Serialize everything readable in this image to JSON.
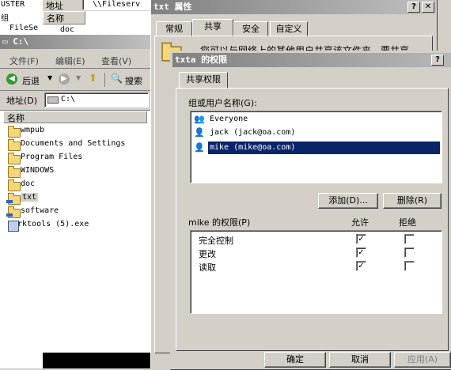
{
  "background_window": {
    "title_fragment": "USTER",
    "item": "组",
    "item2": "FileSe"
  },
  "second_window": {
    "address_label": "地址",
    "address_value": "\\\\Fileserv",
    "column_name": "名称",
    "row1": "doc"
  },
  "explorer": {
    "title": "C:\\",
    "menu": [
      "文件(F)",
      "编辑(E)",
      "查看(V)"
    ],
    "back_label": "后退",
    "search_label": "搜索",
    "address_label": "地址(D)",
    "address_value": "C:\\",
    "column_name": "名称",
    "items": [
      {
        "name": "wmpub",
        "icon": "folder-icon"
      },
      {
        "name": "Documents and Settings",
        "icon": "folder-icon"
      },
      {
        "name": "Program Files",
        "icon": "folder-icon"
      },
      {
        "name": "WINDOWS",
        "icon": "folder-icon"
      },
      {
        "name": "doc",
        "icon": "folder-icon"
      },
      {
        "name": "txt",
        "icon": "shared-folder-icon"
      },
      {
        "name": "software",
        "icon": "shared-folder-icon"
      },
      {
        "name": "rktools (5).exe",
        "icon": "exe-icon"
      }
    ]
  },
  "properties": {
    "title": "txt 属性",
    "tabs": [
      "常规",
      "共享",
      "安全",
      "自定义"
    ],
    "active_tab": "共享",
    "text_fragment": "您可以与网络上的其他用户共享该文件夹。要共享"
  },
  "permissions": {
    "title": "txta 的权限",
    "tab": "共享权限",
    "group_label": "组或用户名称(G):",
    "users": [
      {
        "name": "Everyone",
        "selected": false
      },
      {
        "name": "jack (jack@oa.com)",
        "selected": false
      },
      {
        "name": "mike (mike@oa.com)",
        "selected": true
      }
    ],
    "add_button": "添加(D)...",
    "remove_button": "删除(R)",
    "perm_label": "mike 的权限(P)",
    "allow_header": "允许",
    "deny_header": "拒绝",
    "rows": [
      {
        "name": "完全控制",
        "allow": true,
        "deny": false
      },
      {
        "name": "更改",
        "allow": true,
        "deny": false
      },
      {
        "name": "读取",
        "allow": true,
        "deny": false
      }
    ],
    "ok": "确定",
    "cancel": "取消",
    "apply": "应用(A)"
  },
  "colors": {
    "title_active": "#0a246a",
    "title_inactive": "#808080",
    "selection": "#0a246a"
  }
}
